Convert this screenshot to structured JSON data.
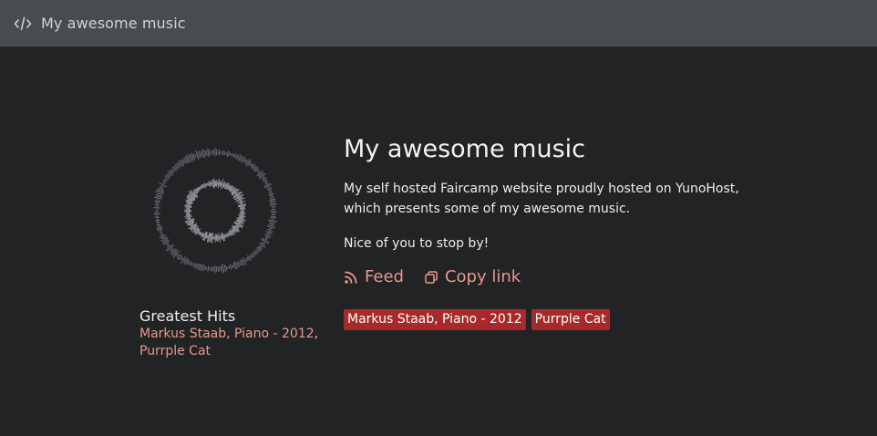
{
  "header": {
    "title": "My awesome music",
    "icon": "code-icon"
  },
  "release": {
    "title": "Greatest Hits",
    "artists": [
      {
        "name": "Markus Staab, Piano - 2012"
      },
      {
        "name": "Purrple Cat"
      }
    ],
    "separator": ","
  },
  "main": {
    "title": "My awesome music",
    "description": "My self hosted Faircamp website proudly hosted on YunoHost, which presents some of my awesome music.",
    "greeting": "Nice of you to stop by!",
    "feed_label": "Feed",
    "feed_icon": "rss-icon",
    "copy_label": "Copy link",
    "copy_icon": "copy-icon",
    "tags": [
      "Markus Staab, Piano - 2012",
      "Purrple Cat"
    ]
  },
  "colors": {
    "background": "#222325",
    "header": "#474c51",
    "accent": "#e8978f",
    "tag": "#a8292a"
  }
}
